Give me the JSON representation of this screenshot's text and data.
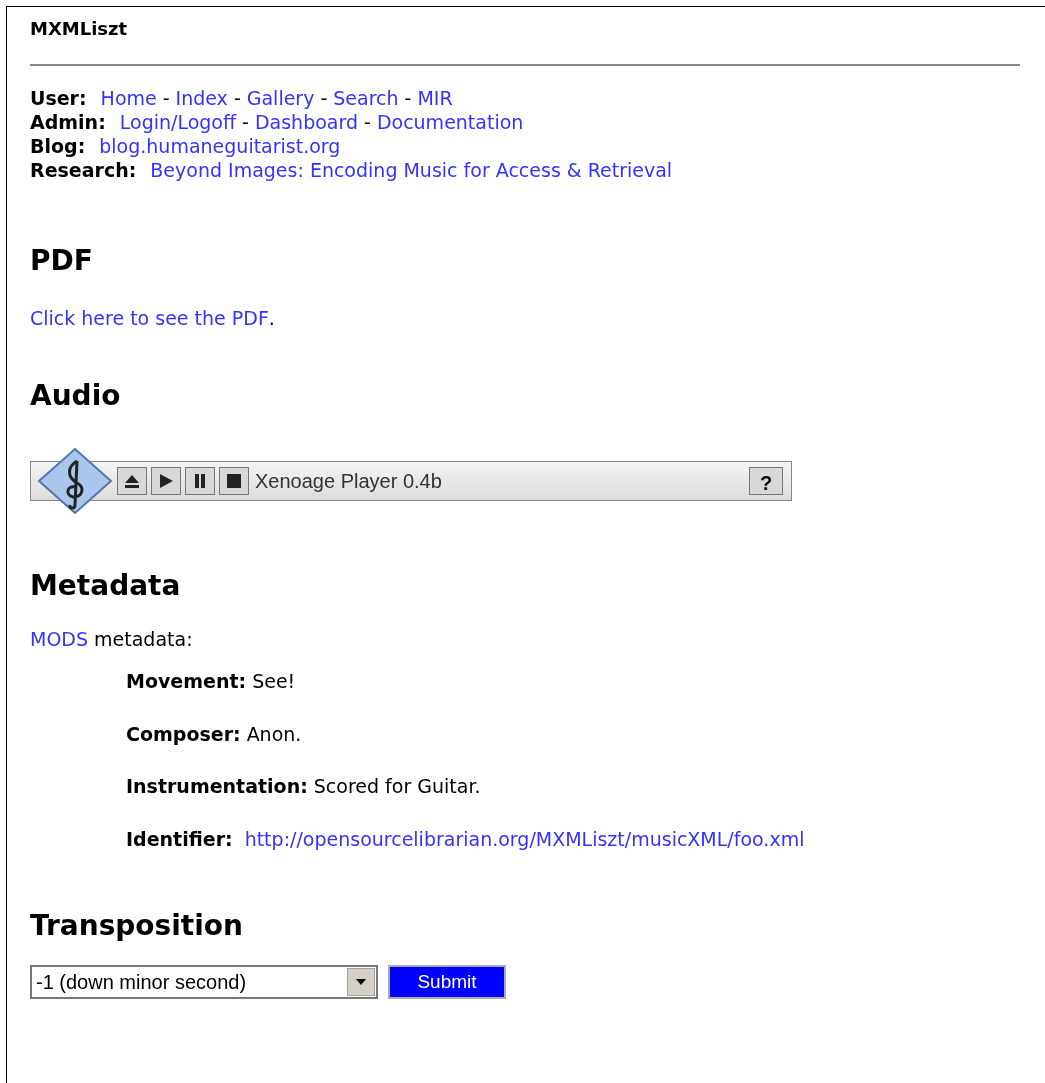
{
  "site_title": "MXMLiszt",
  "nav": [
    {
      "label": "User:",
      "items": [
        {
          "kind": "link",
          "text": "Home"
        },
        {
          "kind": "sep",
          "text": "-"
        },
        {
          "kind": "link",
          "text": "Index"
        },
        {
          "kind": "sep",
          "text": "-"
        },
        {
          "kind": "link",
          "text": "Gallery"
        },
        {
          "kind": "sep",
          "text": "-"
        },
        {
          "kind": "link",
          "text": "Search"
        },
        {
          "kind": "sep",
          "text": "-"
        },
        {
          "kind": "link",
          "text": "MIR"
        }
      ]
    },
    {
      "label": "Admin:",
      "items": [
        {
          "kind": "link",
          "text": "Login/Logoff"
        },
        {
          "kind": "sep",
          "text": "-"
        },
        {
          "kind": "link",
          "text": "Dashboard"
        },
        {
          "kind": "sep",
          "text": "-"
        },
        {
          "kind": "link",
          "text": "Documentation"
        }
      ]
    },
    {
      "label": "Blog:",
      "items": [
        {
          "kind": "link",
          "text": "blog.humaneguitarist.org"
        }
      ]
    },
    {
      "label": "Research:",
      "items": [
        {
          "kind": "link",
          "text": "Beyond Images: Encoding Music for Access & Retrieval"
        }
      ]
    }
  ],
  "pdf": {
    "heading": "PDF",
    "link": "Click here to see the PDF",
    "after": "."
  },
  "audio": {
    "heading": "Audio",
    "player": {
      "title": "Xenoage Player 0.4b",
      "help": "?"
    }
  },
  "metadata": {
    "heading": "Metadata",
    "link": "MODS",
    "after": "metadata:",
    "fields": [
      {
        "label": "Movement:",
        "value": "See!",
        "kind": "text"
      },
      {
        "label": "Composer:",
        "value": "Anon.",
        "kind": "text"
      },
      {
        "label": "Instrumentation:",
        "value": "Scored for Guitar.",
        "kind": "text"
      },
      {
        "label": "Identifier:",
        "value": "http://opensourcelibrarian.org/MXMLiszt/musicXML/foo.xml",
        "kind": "link"
      }
    ]
  },
  "transposition": {
    "heading": "Transposition",
    "select_value": "-1 (down minor second)",
    "submit": "Submit"
  }
}
